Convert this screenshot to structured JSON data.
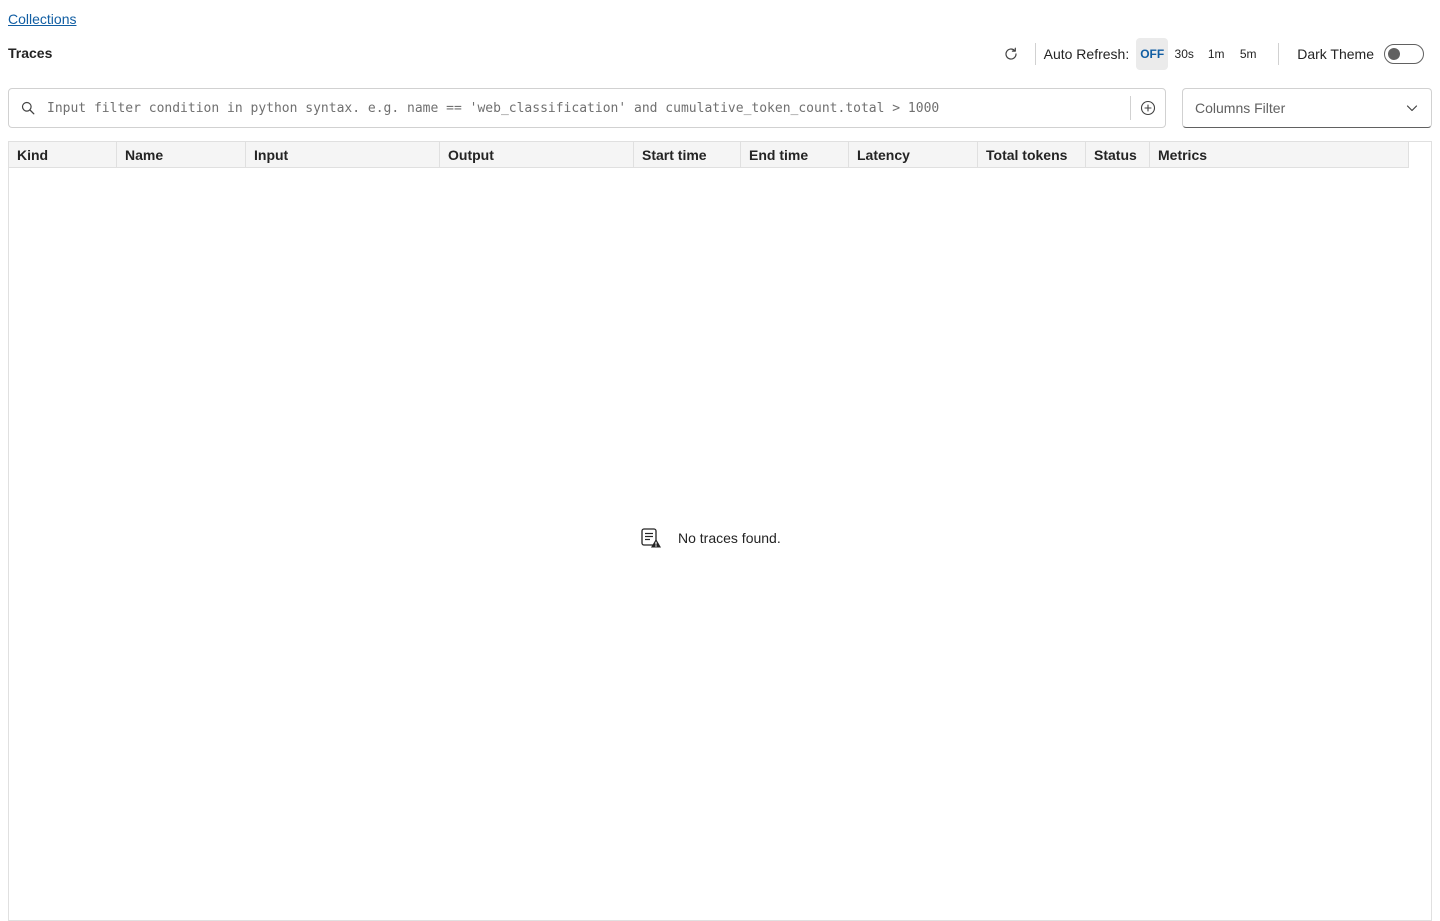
{
  "breadcrumb": {
    "label": "Collections"
  },
  "page": {
    "title": "Traces"
  },
  "toolbar": {
    "refresh_icon": "refresh-icon",
    "auto_refresh_label": "Auto Refresh:",
    "intervals": [
      "OFF",
      "30s",
      "1m",
      "5m"
    ],
    "selected_interval": "OFF",
    "dark_theme_label": "Dark Theme",
    "dark_theme_on": false
  },
  "search": {
    "placeholder": "Input filter condition in python syntax. e.g. name == 'web_classification' and cumulative_token_count.total > 1000",
    "value": "",
    "icon": "search-icon",
    "add_icon": "add-circle-icon"
  },
  "columns_filter": {
    "label": "Columns Filter",
    "icon": "chevron-down-icon"
  },
  "table": {
    "columns": [
      "Kind",
      "Name",
      "Input",
      "Output",
      "Start time",
      "End time",
      "Latency",
      "Total tokens",
      "Status",
      "Metrics"
    ],
    "rows": []
  },
  "empty_state": {
    "message": "No traces found.",
    "icon": "document-warning-icon"
  },
  "colors": {
    "accent": "#115ea3",
    "link": "#115ea3",
    "border": "#e0e0e0",
    "header_bg": "#f5f5f5"
  }
}
